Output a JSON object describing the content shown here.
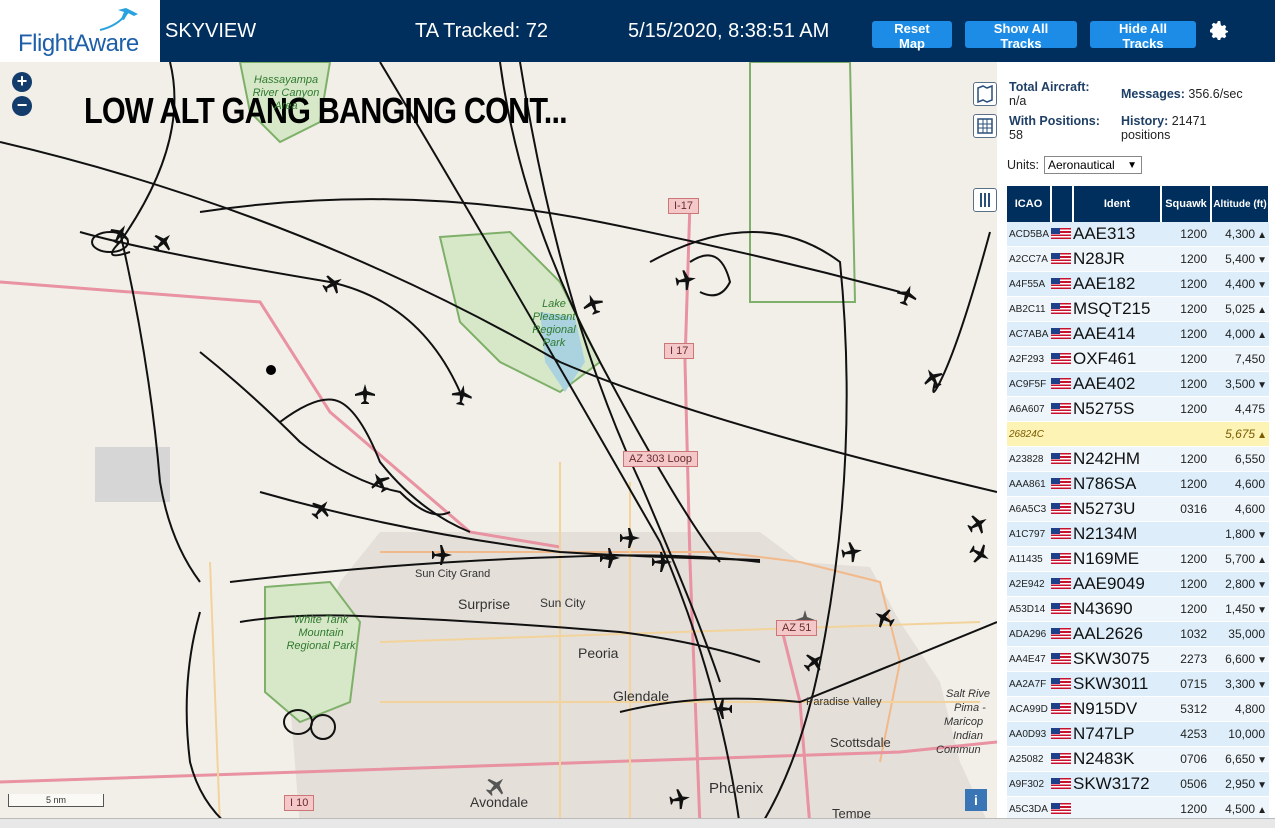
{
  "header": {
    "logo_text": "FlightAware",
    "title": "SKYVIEW",
    "tracked": "TA Tracked: 72",
    "datetime": "5/15/2020, 8:38:51 AM",
    "buttons": {
      "reset": "Reset Map",
      "show": "Show All Tracks",
      "hide": "Hide All Tracks"
    }
  },
  "map": {
    "overlay_text": "LOW ALT GANG BANGING CONT...",
    "zoom_in": "+",
    "zoom_out": "−",
    "scale": "5 nm",
    "info": "i",
    "places": [
      "Sun City Grand",
      "Surprise",
      "Sun City",
      "Peoria",
      "Glendale",
      "Paradise Valley",
      "Scottsdale",
      "Phoenix",
      "Avondale",
      "Tempe",
      "Salt Rive",
      "Pima -",
      "Maricop",
      "Indian",
      "Commun"
    ],
    "parks": {
      "hassayampa": "Hassayampa River Canyon Area",
      "lake_pleasant": "Lake Pleasant Regional Park",
      "white_tank": "White Tank Mountain Regional Park"
    },
    "roads": {
      "i17_top": "I-17",
      "i17_mid": "I 17",
      "az303": "AZ 303 Loop",
      "az51": "AZ 51",
      "i10": "I 10"
    }
  },
  "panel": {
    "total_aircraft_label": "Total Aircraft:",
    "total_aircraft_value": "n/a",
    "messages_label": "Messages:",
    "messages_value": "356.6/sec",
    "with_positions_label": "With Positions:",
    "with_positions_value": "58",
    "history_label": "History:",
    "history_value": "21471",
    "history_unit": "positions",
    "units_label": "Units:",
    "units_value": "Aeronautical",
    "columns": [
      "ICAO",
      "Ident",
      "Squawk",
      "Altitude (ft)"
    ],
    "rows": [
      {
        "icao": "ACD5BA",
        "ident": "AAE313",
        "squawk": "1200",
        "alt": "4,300",
        "trend": "▲"
      },
      {
        "icao": "A2CC7A",
        "ident": "N28JR",
        "squawk": "1200",
        "alt": "5,400",
        "trend": "▼"
      },
      {
        "icao": "A4F55A",
        "ident": "AAE182",
        "squawk": "1200",
        "alt": "4,400",
        "trend": "▼"
      },
      {
        "icao": "AB2C11",
        "ident": "MSQT215",
        "squawk": "1200",
        "alt": "5,025",
        "trend": "▲"
      },
      {
        "icao": "AC7ABA",
        "ident": "AAE414",
        "squawk": "1200",
        "alt": "4,000",
        "trend": "▲"
      },
      {
        "icao": "A2F293",
        "ident": "OXF461",
        "squawk": "1200",
        "alt": "7,450",
        "trend": ""
      },
      {
        "icao": "AC9F5F",
        "ident": "AAE402",
        "squawk": "1200",
        "alt": "3,500",
        "trend": "▼"
      },
      {
        "icao": "A6A607",
        "ident": "N5275S",
        "squawk": "1200",
        "alt": "4,475",
        "trend": ""
      },
      {
        "icao": "26824C",
        "ident": "",
        "squawk": "",
        "alt": "5,675",
        "trend": "▲"
      },
      {
        "icao": "A23828",
        "ident": "N242HM",
        "squawk": "1200",
        "alt": "6,550",
        "trend": ""
      },
      {
        "icao": "AAA861",
        "ident": "N786SA",
        "squawk": "1200",
        "alt": "4,600",
        "trend": ""
      },
      {
        "icao": "A6A5C3",
        "ident": "N5273U",
        "squawk": "0316",
        "alt": "4,600",
        "trend": ""
      },
      {
        "icao": "A1C797",
        "ident": "N2134M",
        "squawk": "",
        "alt": "1,800",
        "trend": "▼"
      },
      {
        "icao": "A11435",
        "ident": "N169ME",
        "squawk": "1200",
        "alt": "5,700",
        "trend": "▲"
      },
      {
        "icao": "A2E942",
        "ident": "AAE9049",
        "squawk": "1200",
        "alt": "2,800",
        "trend": "▼"
      },
      {
        "icao": "A53D14",
        "ident": "N43690",
        "squawk": "1200",
        "alt": "1,450",
        "trend": "▼"
      },
      {
        "icao": "ADA296",
        "ident": "AAL2626",
        "squawk": "1032",
        "alt": "35,000",
        "trend": ""
      },
      {
        "icao": "AA4E47",
        "ident": "SKW3075",
        "squawk": "2273",
        "alt": "6,600",
        "trend": "▼"
      },
      {
        "icao": "AA2A7F",
        "ident": "SKW3011",
        "squawk": "0715",
        "alt": "3,300",
        "trend": "▼"
      },
      {
        "icao": "ACA99D",
        "ident": "N915DV",
        "squawk": "5312",
        "alt": "4,800",
        "trend": ""
      },
      {
        "icao": "AA0D93",
        "ident": "N747LP",
        "squawk": "4253",
        "alt": "10,000",
        "trend": ""
      },
      {
        "icao": "A25082",
        "ident": "N2483K",
        "squawk": "0706",
        "alt": "6,650",
        "trend": "▼"
      },
      {
        "icao": "A9F302",
        "ident": "SKW3172",
        "squawk": "0506",
        "alt": "2,950",
        "trend": "▼"
      },
      {
        "icao": "A5C3DA",
        "ident": "",
        "squawk": "1200",
        "alt": "4,500",
        "trend": "▲"
      }
    ]
  },
  "colors": {
    "header_bg": "#002f5d",
    "button": "#1c8ce6",
    "row": "#ddeefa",
    "highlight": "#fdf3b5"
  }
}
